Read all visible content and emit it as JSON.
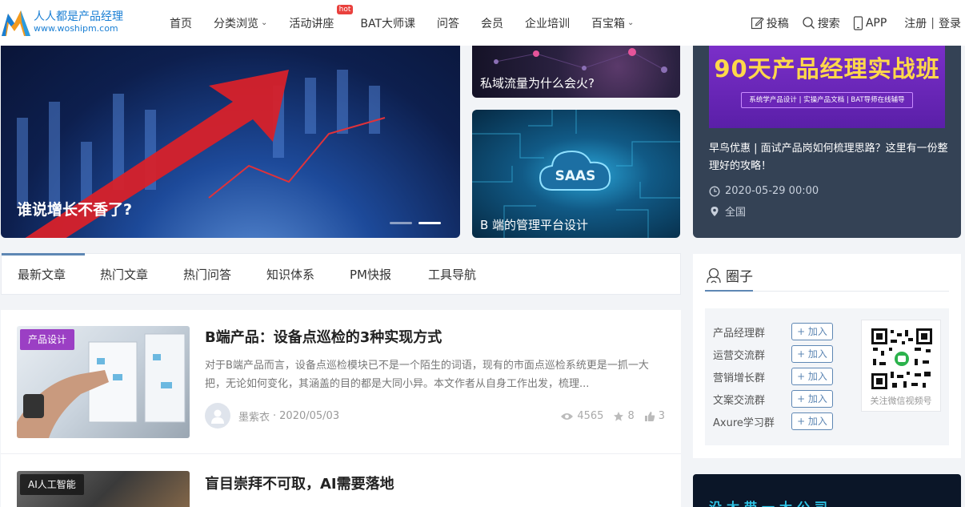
{
  "brand": {
    "name": "人人都是产品经理",
    "url": "www.woshipm.com"
  },
  "nav": {
    "items": [
      {
        "label": "首页",
        "has_dropdown": false
      },
      {
        "label": "分类浏览",
        "has_dropdown": true
      },
      {
        "label": "活动讲座",
        "has_dropdown": false,
        "badge": "hot"
      },
      {
        "label": "BAT大师课",
        "has_dropdown": false
      },
      {
        "label": "问答",
        "has_dropdown": false
      },
      {
        "label": "会员",
        "has_dropdown": false
      },
      {
        "label": "企业培训",
        "has_dropdown": false
      },
      {
        "label": "百宝箱",
        "has_dropdown": true
      }
    ]
  },
  "tools": {
    "submit": "投稿",
    "search": "搜索",
    "app": "APP",
    "register": "注册",
    "separator": "|",
    "login": "登录"
  },
  "hero": {
    "main_title": "谁说增长不香了?",
    "side1_title": "私域流量为什么会火?",
    "side2_title": "B 端的管理平台设计",
    "side2_graphic_text": "SAAS",
    "slides": 2,
    "active_slide": 2
  },
  "promo": {
    "banner_title": "90天产品经理实战班",
    "banner_sub": "系统学产品设计 | 实操产品文档 | BAT导师在线辅导",
    "text": "早鸟优惠 | 面试产品岗如何梳理思路？这里有一份整理好的攻略！",
    "date": "2020-05-29 00:00",
    "location": "全国"
  },
  "tabs": [
    "最新文章",
    "热门文章",
    "热门问答",
    "知识体系",
    "PM快报",
    "工具导航"
  ],
  "articles": [
    {
      "tag": "产品设计",
      "title": "B端产品：设备点巡检的3种实现方式",
      "desc": "对于B端产品而言，设备点巡检模块已不是一个陌生的词语，现有的市面点巡检系统更是一抓一大把，无论如何变化，其涵盖的目的都是大同小异。本文作者从自身工作出发，梳理...",
      "author": "墨紫衣",
      "date_sep": "·",
      "date": "2020/05/03",
      "views": "4565",
      "stars": "8",
      "likes": "3"
    },
    {
      "tag": "AI人工智能",
      "title": "盲目崇拜不可取，AI需要落地"
    }
  ],
  "circle": {
    "title": "圈子",
    "groups": [
      "产品经理群",
      "运营交流群",
      "营销增长群",
      "文案交流群",
      "Axure学习群"
    ],
    "join_label": "+ 加入",
    "qr_caption": "关注微信视频号"
  },
  "bottom_ad": {
    "text": "没太带一大公司"
  },
  "colors": {
    "accent": "#5e87b4",
    "brand": "#1a7fd4",
    "promo_bg": "#344255",
    "tag_purple": "#9b3fc4",
    "hot": "#e9413d"
  }
}
